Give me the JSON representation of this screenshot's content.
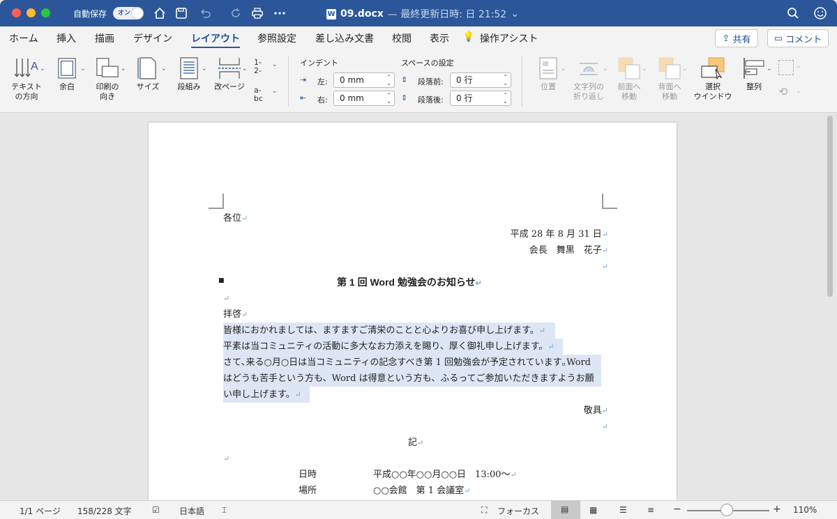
{
  "titlebar": {
    "autosave_label": "自動保存",
    "autosave_state": "オン",
    "doc_name": "09.docx",
    "doc_status": "— 最終更新日時: 日 21:52",
    "app_badge": "W",
    "accent": "#2b579a"
  },
  "tabs": [
    "ホーム",
    "挿入",
    "描画",
    "デザイン",
    "レイアウト",
    "参照設定",
    "差し込み文書",
    "校閲",
    "表示"
  ],
  "active_tab": "レイアウト",
  "assist_label": "操作アシスト",
  "share_label": "共有",
  "comment_label": "コメント",
  "ribbon": {
    "text_direction": "テキスト\nの方向",
    "margins": "余白",
    "orientation": "印刷の\n向き",
    "size": "サイズ",
    "columns": "段組み",
    "breaks": "改ページ",
    "indent_title": "インデント",
    "indent_left_label": "左:",
    "indent_left_value": "0 mm",
    "indent_right_label": "右:",
    "indent_right_value": "0 mm",
    "spacing_title": "スペースの設定",
    "spacing_before_label": "段落前:",
    "spacing_before_value": "0 行",
    "spacing_after_label": "段落後:",
    "spacing_after_value": "0 行",
    "position": "位置",
    "wrap_text": "文字列の\n折り返し",
    "bring_forward": "前面へ\n移動",
    "send_backward": "背面へ\n移動",
    "selection_pane": "選択\nウインドウ",
    "align": "整列"
  },
  "document": {
    "addressee": "各位",
    "date": "平成 28 年 8 月 31 日",
    "sender": "会長　舞黒　花子",
    "title": "第 1 回 Word 勉強会のお知らせ",
    "greeting": "拝啓",
    "body_1": "皆様におかれましては、ますますご清栄のことと心よりお喜び申し上げます。",
    "body_2": "平素は当コミュニティの活動に多大なお力添えを賜り、厚く御礼申し上げます。",
    "body_3": "さて､来る○月○日は当コミュニティの記念すべき第 1 回勉強会が予定されています｡Word",
    "body_4": "はどうも苦手という方も、Word は得意という方も、ふるってご参加いただきますようお願",
    "body_5": "い申し上げます。",
    "closing": "敬具",
    "ki": "記",
    "row1_label": "日時",
    "row1_value": "平成○○年○○月○○日　13:00～",
    "row2_label": "場所",
    "row2_value": "○○会館　第 1 会議室",
    "para_mark": "↵"
  },
  "statusbar": {
    "page": "1/1 ページ",
    "words": "158/228 文字",
    "language": "日本語",
    "focus": "フォーカス",
    "zoom": "110%",
    "minus": "−",
    "plus": "+"
  }
}
